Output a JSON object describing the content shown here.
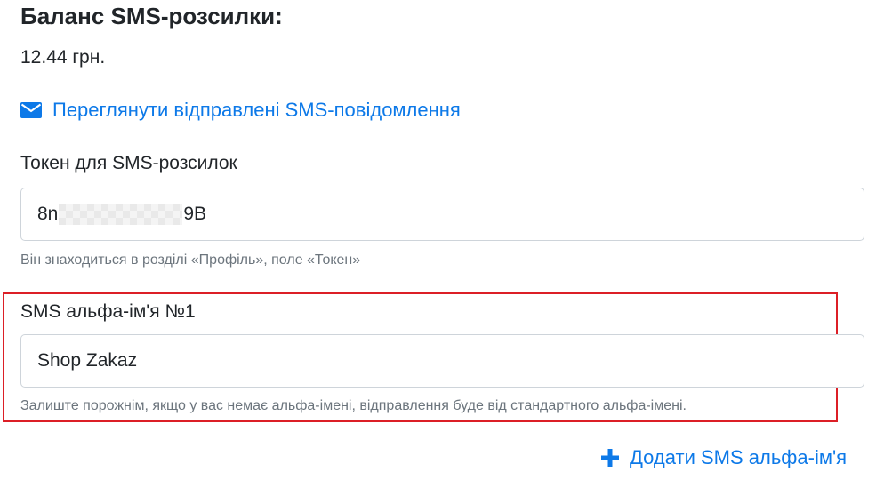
{
  "balance": {
    "title": "Баланс SMS-розсилки:",
    "value": "12.44 грн."
  },
  "sent_link": {
    "label": "Переглянути відправлені SMS-повідомлення",
    "icon": "envelope-icon"
  },
  "token_field": {
    "label": "Токен для SMS-розсилок",
    "value_prefix": "8n",
    "value_suffix": "9B",
    "help": "Він знаходиться в розділі «Профіль», поле «Токен»"
  },
  "alpha_field": {
    "label": "SMS альфа-ім'я №1",
    "value": "Shop Zakaz",
    "help": "Залиште порожнім, якщо у вас немає альфа-імені, відправлення буде від стандартного альфа-імені."
  },
  "add_link": {
    "label": "Додати SMS альфа-ім'я",
    "icon": "plus-icon"
  },
  "colors": {
    "link": "#0d79e8",
    "text": "#212529",
    "muted": "#6c757d",
    "border": "#ced4da",
    "highlight": "#dc1f26"
  }
}
